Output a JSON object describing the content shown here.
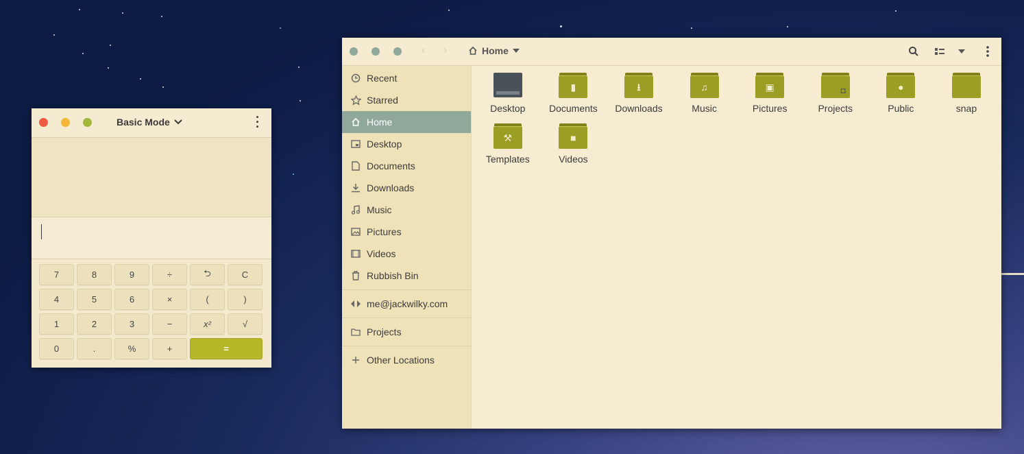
{
  "calculator": {
    "title": "Basic Mode",
    "keys": [
      {
        "label": "7"
      },
      {
        "label": "8"
      },
      {
        "label": "9"
      },
      {
        "label": "÷"
      },
      {
        "label": "⮌"
      },
      {
        "label": "C"
      },
      {
        "label": "4"
      },
      {
        "label": "5"
      },
      {
        "label": "6"
      },
      {
        "label": "×"
      },
      {
        "label": "("
      },
      {
        "label": ")"
      },
      {
        "label": "1"
      },
      {
        "label": "2"
      },
      {
        "label": "3"
      },
      {
        "label": "−"
      },
      {
        "label": "x²"
      },
      {
        "label": "√"
      },
      {
        "label": "0"
      },
      {
        "label": "."
      },
      {
        "label": "%"
      },
      {
        "label": "+"
      },
      {
        "label": "="
      }
    ],
    "accent": "#b6b829"
  },
  "files": {
    "location": "Home",
    "sidebar": [
      {
        "label": "Recent",
        "icon": "clock-icon"
      },
      {
        "label": "Starred",
        "icon": "star-icon"
      },
      {
        "label": "Home",
        "icon": "home-icon",
        "active": true
      },
      {
        "label": "Desktop",
        "icon": "desktop-icon"
      },
      {
        "label": "Documents",
        "icon": "document-icon"
      },
      {
        "label": "Downloads",
        "icon": "download-icon"
      },
      {
        "label": "Music",
        "icon": "music-icon"
      },
      {
        "label": "Pictures",
        "icon": "picture-icon"
      },
      {
        "label": "Videos",
        "icon": "video-icon"
      },
      {
        "label": "Rubbish Bin",
        "icon": "trash-icon"
      },
      {
        "label": "me@jackwilky.com",
        "icon": "network-icon"
      },
      {
        "label": "Projects",
        "icon": "folder-icon"
      },
      {
        "label": "Other Locations",
        "icon": "plus-icon"
      }
    ],
    "items": [
      {
        "label": "Desktop",
        "icon": "desktop-folder-icon"
      },
      {
        "label": "Documents",
        "icon": "documents-folder-icon"
      },
      {
        "label": "Downloads",
        "icon": "downloads-folder-icon"
      },
      {
        "label": "Music",
        "icon": "music-folder-icon"
      },
      {
        "label": "Pictures",
        "icon": "pictures-folder-icon"
      },
      {
        "label": "Projects",
        "icon": "projects-folder-icon"
      },
      {
        "label": "Public",
        "icon": "public-folder-icon"
      },
      {
        "label": "snap",
        "icon": "folder-icon"
      },
      {
        "label": "Templates",
        "icon": "templates-folder-icon"
      },
      {
        "label": "Videos",
        "icon": "videos-folder-icon"
      }
    ],
    "folder_color": "#9a9e24",
    "selection_color": "#8fa89a"
  }
}
